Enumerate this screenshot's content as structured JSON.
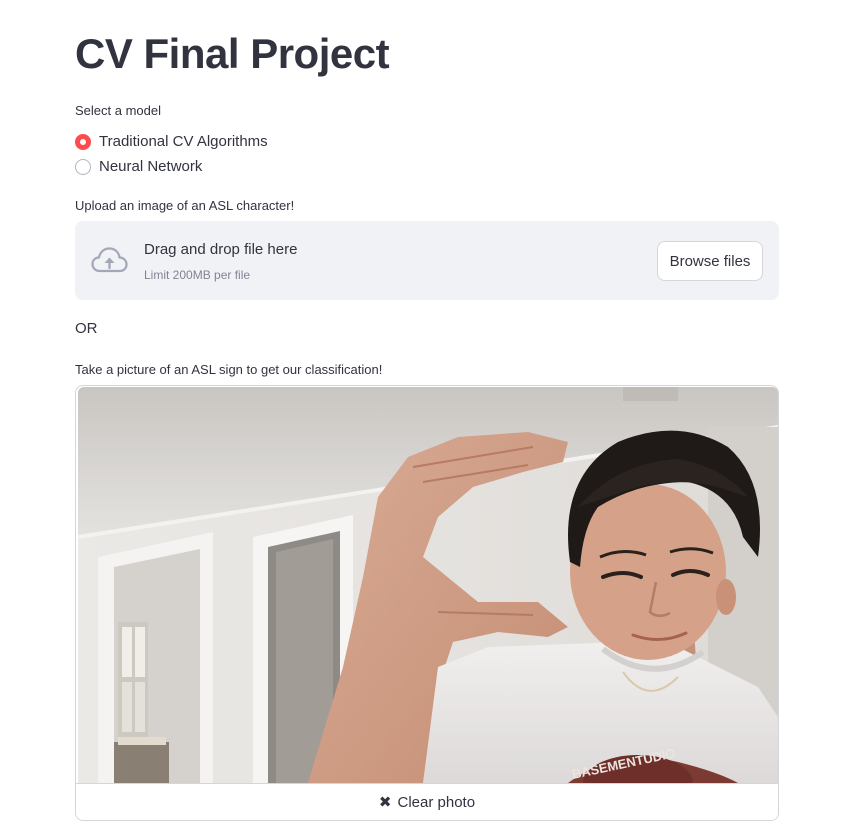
{
  "page": {
    "title": "CV Final Project"
  },
  "model_select": {
    "label": "Select a model",
    "options": [
      {
        "label": "Traditional CV Algorithms",
        "selected": true
      },
      {
        "label": "Neural Network",
        "selected": false
      }
    ]
  },
  "uploader": {
    "label": "Upload an image of an ASL character!",
    "drag_text": "Drag and drop file here",
    "limit_text": "Limit 200MB per file",
    "browse_label": "Browse files",
    "icon": "cloud-upload-icon"
  },
  "separator": {
    "text": "OR"
  },
  "camera": {
    "label": "Take a picture of an ASL sign to get our classification!",
    "clear_label": "Clear photo",
    "clear_icon": "close-icon",
    "shirt_text": "BASEMENTUDIO"
  },
  "colors": {
    "accent": "#ff4b4b",
    "text": "#31333f",
    "uploader_bg": "#f0f2f6",
    "muted": "#808495"
  }
}
